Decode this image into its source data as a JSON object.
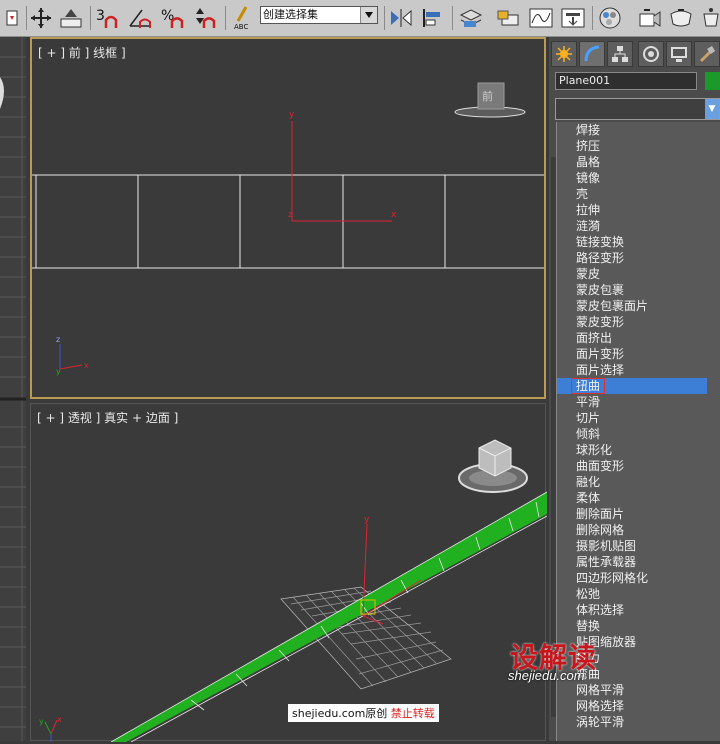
{
  "toolbar": {
    "selection_set_value": "创建选择集",
    "buttons": [
      "undo-redo",
      "select-move",
      "select-scale",
      "snaps-toggle",
      "angle-snap",
      "percent-snap",
      "spinner-snap",
      "edit-named-selection",
      "mirror",
      "align",
      "layer-manager",
      "graphite-toggle",
      "curve-editor",
      "schematic-view",
      "material-editor",
      "render-setup",
      "rendered-frame",
      "render"
    ]
  },
  "viewports": {
    "front_label": "[ + ] 前 ] 线框 ]",
    "persp_label": "[ + ] 透视 ] 真实 + 边面 ]",
    "viewcube_front": "前"
  },
  "command_panel": {
    "tabs": [
      "create",
      "modify",
      "hierarchy",
      "motion",
      "display",
      "utilities"
    ],
    "object_name": "Plane001",
    "object_color": "#1a9a2a",
    "modifier_list_value": ""
  },
  "modifier_list": {
    "items": [
      "焊接",
      "挤压",
      "晶格",
      "镜像",
      "壳",
      "拉伸",
      "涟漪",
      "链接变换",
      "路径变形",
      "蒙皮",
      "蒙皮包裹",
      "蒙皮包裹面片",
      "蒙皮变形",
      "面挤出",
      "面片变形",
      "面片选择",
      "扭曲",
      "平滑",
      "切片",
      "倾斜",
      "球形化",
      "曲面变形",
      "融化",
      "柔体",
      "删除面片",
      "删除网格",
      "摄影机贴图",
      "属性承载器",
      "四边形网格化",
      "松弛",
      "体积选择",
      "替换",
      "贴图缩放器",
      "推力",
      "弯曲",
      "网格平滑",
      "网格选择",
      "涡轮平滑"
    ],
    "selected": "扭曲",
    "selected_color": "#3d7fd6"
  },
  "watermark": {
    "url_text": "shejiedu.com原创",
    "warning": "禁止转载",
    "logo": "设解读",
    "domain": "shejiedu.com"
  }
}
